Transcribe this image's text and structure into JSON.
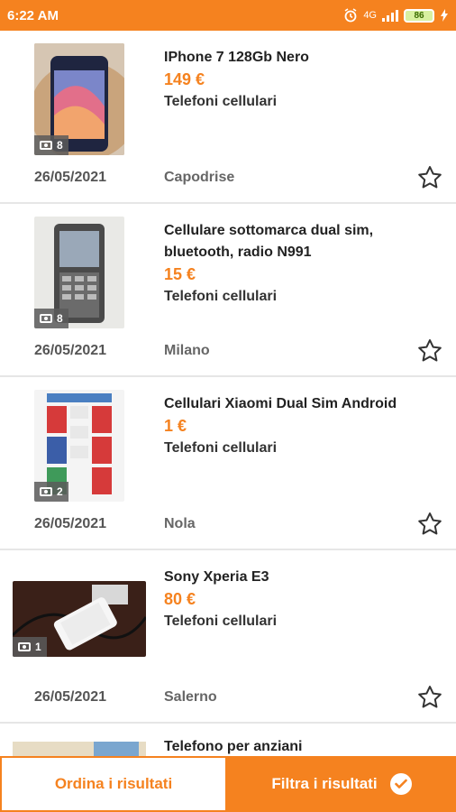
{
  "status_bar": {
    "time": "6:22 AM",
    "network": "4G",
    "battery": "86"
  },
  "listings": [
    {
      "title": "IPhone 7 128Gb Nero",
      "price": "149 €",
      "category": "Telefoni cellulari",
      "date": "26/05/2021",
      "city": "Capodrise",
      "photo_count": "8"
    },
    {
      "title": "Cellulare sottomarca dual sim, bluetooth, radio N991",
      "price": "15 €",
      "category": "Telefoni cellulari",
      "date": "26/05/2021",
      "city": "Milano",
      "photo_count": "8"
    },
    {
      "title": "Cellulari Xiaomi Dual Sim Android",
      "price": "1 €",
      "category": "Telefoni cellulari",
      "date": "26/05/2021",
      "city": "Nola",
      "photo_count": "2"
    },
    {
      "title": "Sony Xperia E3",
      "price": "80 €",
      "category": "Telefoni cellulari",
      "date": "26/05/2021",
      "city": "Salerno",
      "photo_count": "1"
    },
    {
      "title": "Telefono per anziani"
    }
  ],
  "bottom_bar": {
    "sort_label": "Ordina i risultati",
    "filter_label": "Filtra i risultati"
  },
  "colors": {
    "accent": "#f5821f"
  },
  "icons": {
    "photo": "camera-icon",
    "favorite": "star-outline-icon",
    "filter_check": "check-circle-icon"
  }
}
